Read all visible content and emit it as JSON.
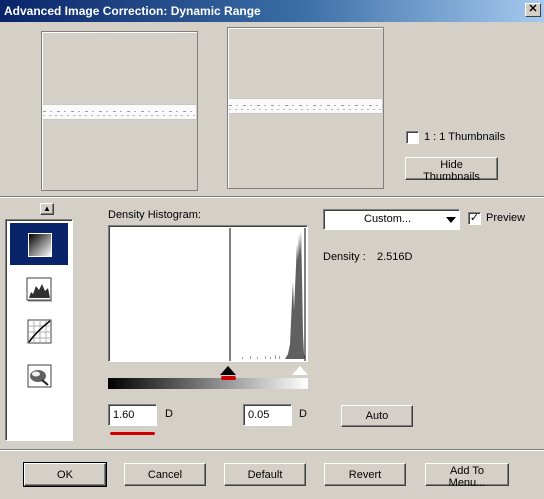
{
  "window": {
    "title": "Advanced Image Correction: Dynamic Range",
    "close_glyph": "✕"
  },
  "thumbnails": {
    "one_to_one_label": "1 : 1 Thumbnails",
    "one_to_one_checked": false,
    "hide_label": "Hide Thumbnails"
  },
  "sidebar": {
    "scroll_up_glyph": "▲",
    "tools": [
      {
        "name": "dynamic-range-tool",
        "selected": true
      },
      {
        "name": "histogram-tool",
        "selected": false
      },
      {
        "name": "curves-tool",
        "selected": false
      },
      {
        "name": "color-balance-tool",
        "selected": false
      }
    ]
  },
  "histogram": {
    "label": "Density Histogram:",
    "preset_value": "Custom...",
    "preview_label": "Preview",
    "preview_checked": true,
    "density_label": "Density :",
    "density_value": "2.516D",
    "min_value": "1.60",
    "min_unit": "D",
    "max_value": "0.05",
    "max_unit": "D",
    "auto_label": "Auto"
  },
  "buttons": {
    "ok": "OK",
    "cancel": "Cancel",
    "default": "Default",
    "revert": "Revert",
    "add_to_menu": "Add To Menu..."
  },
  "colors": {
    "title_start": "#0a246a",
    "title_end": "#a6caf0",
    "marker_red": "#cc0000",
    "face": "#d4d0c8"
  }
}
